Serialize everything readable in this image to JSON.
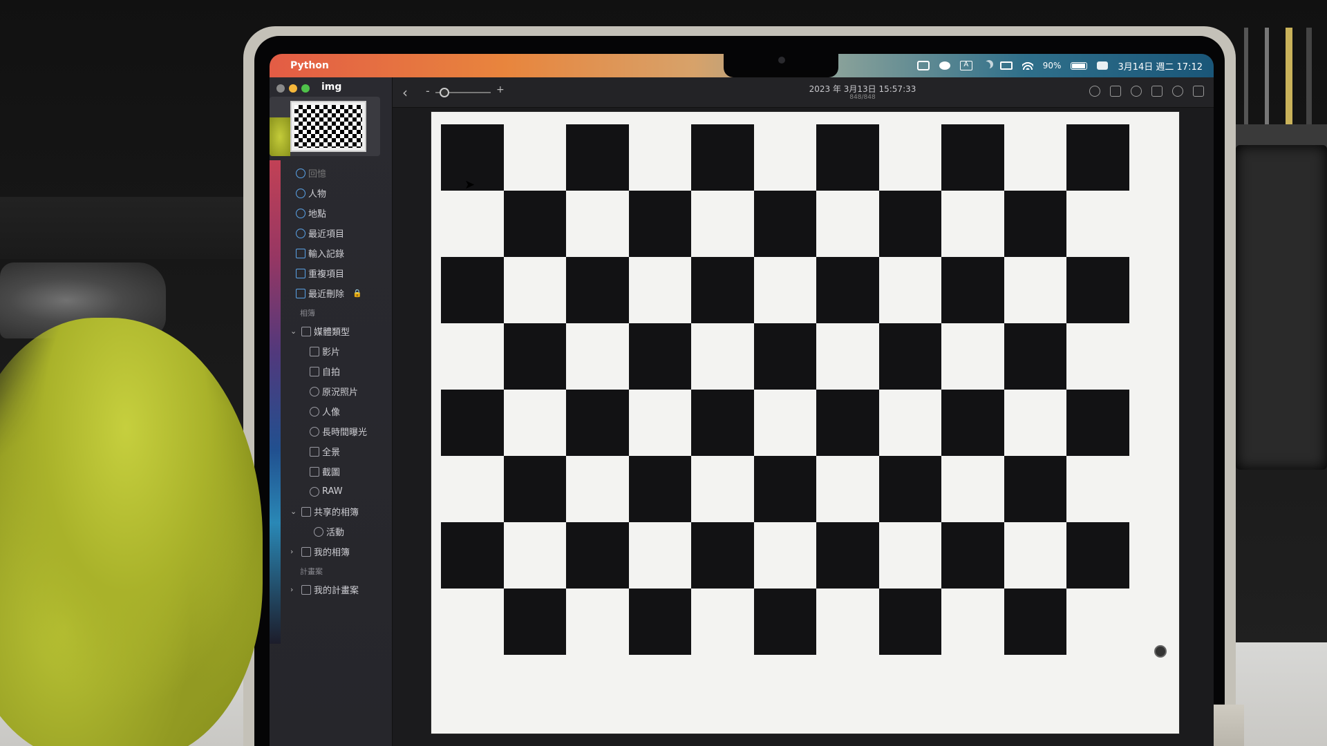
{
  "menubar": {
    "apple_glyph": "",
    "app_name": "Python",
    "battery_percent": "90%",
    "datetime": "3月14日 週二 17:12",
    "status_icons": [
      "calendar-icon",
      "wechat-icon",
      "input-method-icon",
      "focus-moon-icon",
      "display-icon",
      "wifi-icon",
      "battery-icon",
      "control-center-icon"
    ]
  },
  "window": {
    "title": "img"
  },
  "toolbar": {
    "back_glyph": "‹",
    "zoom_minus": "-",
    "zoom_plus": "+",
    "date": "2023 年 3月13日 15:57:33",
    "count": "848/848"
  },
  "sidebar": {
    "library_items": [
      {
        "label": "回憶",
        "icon": "memories-icon"
      },
      {
        "label": "人物",
        "icon": "people-icon"
      },
      {
        "label": "地點",
        "icon": "places-icon"
      },
      {
        "label": "最近項目",
        "icon": "recents-icon"
      },
      {
        "label": "輸入記錄",
        "icon": "imports-icon"
      },
      {
        "label": "重複項目",
        "icon": "duplicates-icon"
      },
      {
        "label": "最近刪除",
        "icon": "trash-icon",
        "lock": "🔒"
      }
    ],
    "albums_header": "相簿",
    "media_types": {
      "label": "媒體類型",
      "items": [
        "影片",
        "自拍",
        "原況照片",
        "人像",
        "長時間曝光",
        "全景",
        "截圖",
        "RAW"
      ]
    },
    "shared_albums": {
      "label": "共享的相簿",
      "items": [
        "活動"
      ]
    },
    "my_albums": "我的相簿",
    "projects_header": "計畫案",
    "my_projects": "我的計畫案"
  },
  "board": {
    "rows": 8,
    "cols": 11
  }
}
